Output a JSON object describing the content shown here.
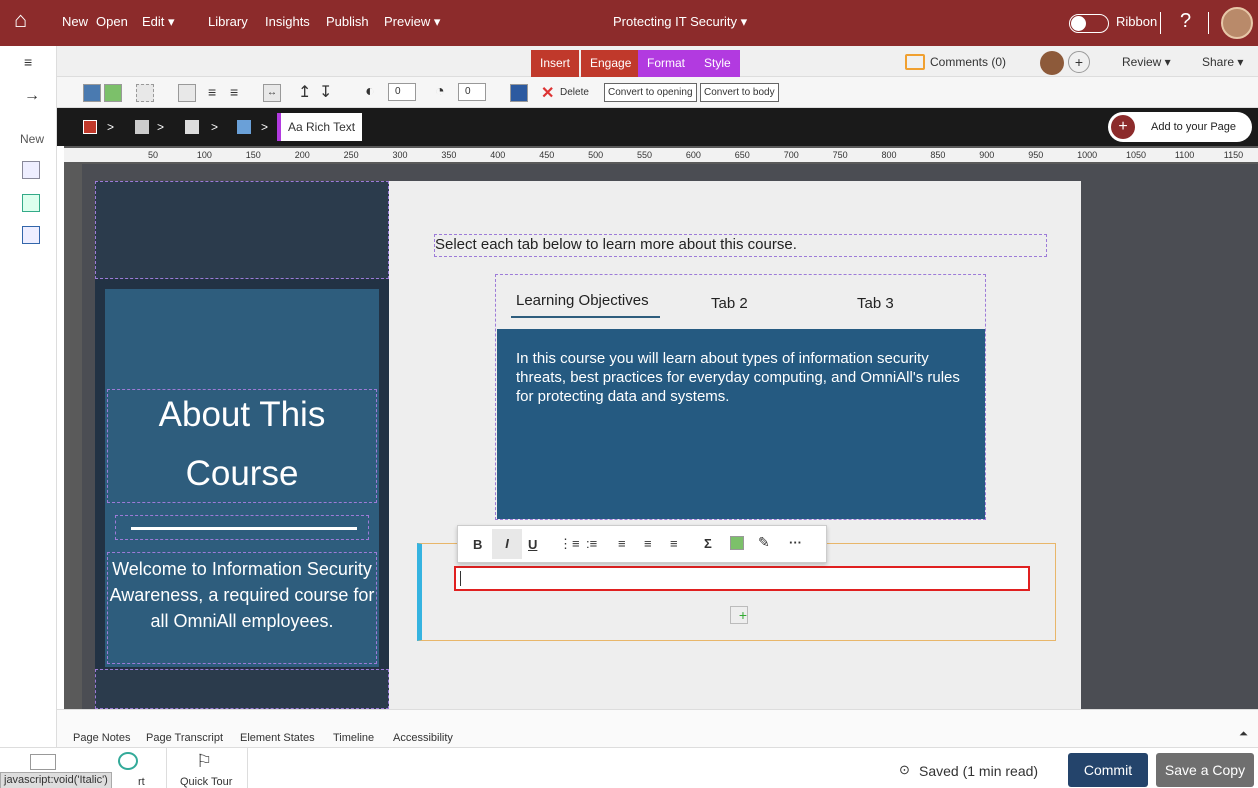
{
  "topbar": {
    "menu": [
      "New",
      "Open",
      "Edit ▾",
      "Library",
      "Insights",
      "Publish",
      "Preview ▾"
    ],
    "title": "Protecting IT Security ▾",
    "ribbon_label": "Ribbon",
    "help": "?"
  },
  "ribbon_tabs": [
    "Insert",
    "Engage",
    "Format",
    "Style"
  ],
  "right_tools": {
    "comments": "Comments (0)",
    "review": "Review ▾",
    "share": "Share ▾"
  },
  "toolbar": {
    "spin1": "0",
    "spin2": "0",
    "delete": "Delete",
    "convert_open": "Convert to opening",
    "convert_body": "Convert to body"
  },
  "left_rail": {
    "new_label": "New"
  },
  "breadcrumb": {
    "current": "Aa Rich Text",
    "add_label": "Add to your Page"
  },
  "ruler_ticks": [
    "50",
    "100",
    "150",
    "200",
    "250",
    "300",
    "350",
    "400",
    "450",
    "500",
    "550",
    "600",
    "650",
    "700",
    "750",
    "800",
    "850",
    "900",
    "950",
    "1000",
    "1050",
    "1100",
    "1150"
  ],
  "panel": {
    "title_line1": "About This",
    "title_line2": "Course",
    "welcome": "Welcome to Information Security Awareness, a required course for all OmniAll employees."
  },
  "content": {
    "instruction": "Select each tab below to learn more about this course.",
    "tabs": [
      "Learning Objectives",
      "Tab 2",
      "Tab 3"
    ],
    "tab_body": "In this course you will learn about types of information security threats, best practices for everyday computing, and OmniAll's rules for protecting data and systems."
  },
  "format_bar": {
    "bold": "B",
    "italic": "I",
    "underline": "U",
    "sigma": "Σ",
    "more": "···"
  },
  "bottom_tabs": [
    "Page Notes",
    "Page Transcript",
    "Element States",
    "Timeline",
    "Accessibility"
  ],
  "footer": {
    "status_url": "javascript:void('Italic')",
    "status_tail": "rt",
    "quick_tour": "Quick Tour",
    "saved": "Saved (1 min read)",
    "commit": "Commit",
    "save_copy": "Save a Copy"
  }
}
